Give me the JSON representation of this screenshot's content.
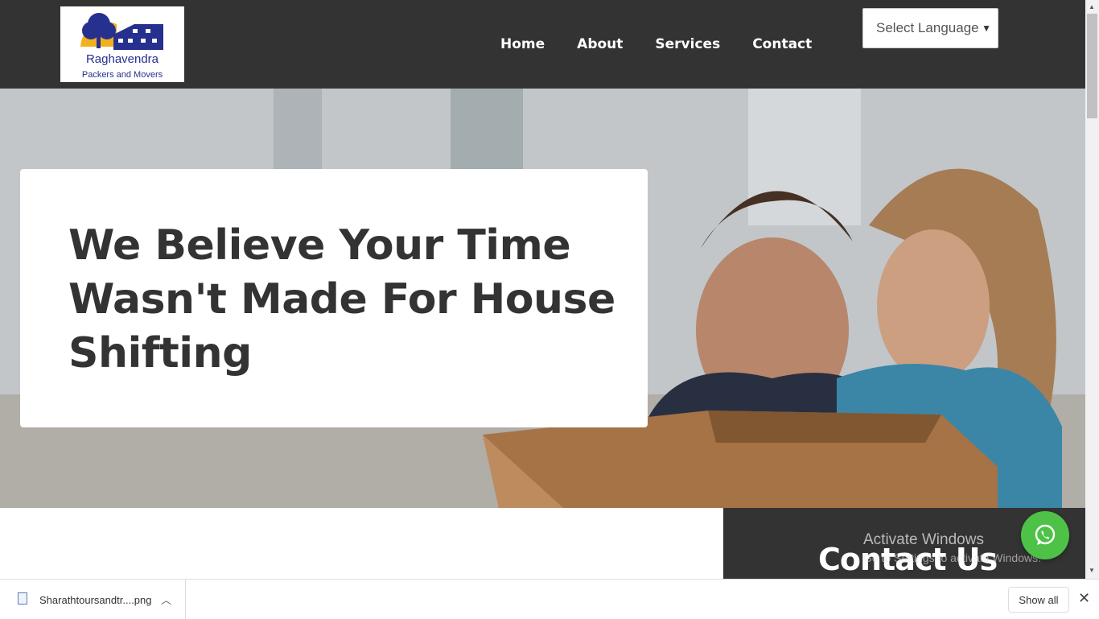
{
  "logo": {
    "name": "Raghavendra",
    "tagline": "Packers and Movers"
  },
  "nav": {
    "items": [
      "Home",
      "About",
      "Services",
      "Contact"
    ]
  },
  "language_select": {
    "value": "Select Language"
  },
  "hero": {
    "title": "We Believe Your Time Wasn't Made For House Shifting"
  },
  "contact": {
    "title": "Contact Us"
  },
  "watermark": {
    "title": "Activate Windows",
    "subtitle": "Go to Settings to activate Windows."
  },
  "download_bar": {
    "file_name": "Sharathtoursandtr....png",
    "show_all": "Show all"
  },
  "colors": {
    "header_bg": "#333333",
    "whatsapp": "#4dc247",
    "logo_blue": "#26308f",
    "logo_sun": "#f2b01e"
  },
  "icons": [
    "whatsapp-icon",
    "file-icon",
    "chevron-up-icon",
    "close-icon",
    "chevron-down-icon"
  ]
}
